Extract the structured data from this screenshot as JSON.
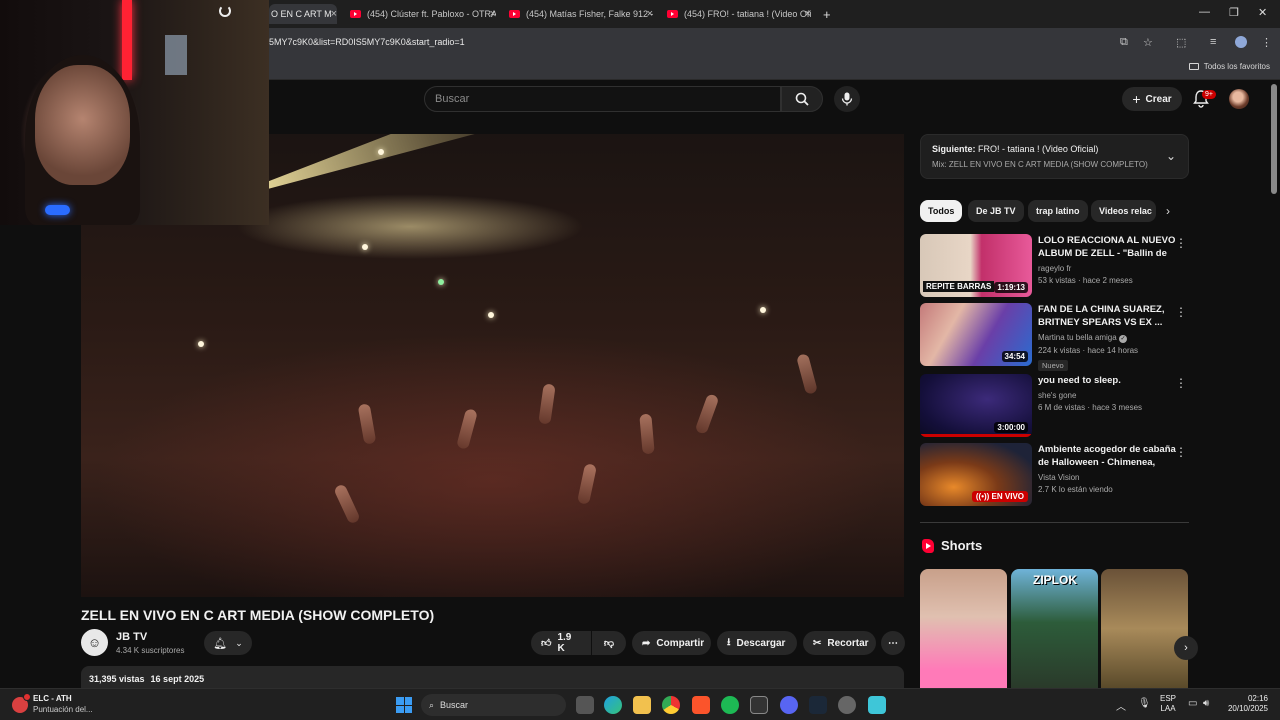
{
  "browser": {
    "tabs": [
      {
        "label": "O EN C ART M"
      },
      {
        "label": "(454) Clúster ft. Pabloxo - OTRA"
      },
      {
        "label": "(454) Matías Fisher, Falke 912 -"
      },
      {
        "label": "(454) FRO! - tatiana ! (Video Ofi"
      }
    ],
    "new_tab": "+",
    "url": "5MY7c9K0&list=RD0IS5MY7c9K0&start_radio=1",
    "bookmarks_all": "Todos los favoritos"
  },
  "header": {
    "search_placeholder": "Buscar",
    "create_label": "Crear",
    "notifications_badge": "9+"
  },
  "video": {
    "title": "ZELL EN VIVO EN C ART MEDIA (SHOW COMPLETO)",
    "channel": "JB TV",
    "subscribers": "4.34 K suscriptores",
    "likes": "1.9 K",
    "share_label": "Compartir",
    "download_label": "Descargar",
    "clip_label": "Recortar",
    "views": "31,395 vistas",
    "date": "16 sept 2025"
  },
  "up_next": {
    "prefix": "Siguiente:",
    "title": "FRO! - tatiana ! (Video Oficial)",
    "mix": "Mix: ZELL EN VIVO EN C ART MEDIA (SHOW COMPLETO)"
  },
  "chips": [
    "Todos",
    "De JB TV",
    "trap latino",
    "Videos relac"
  ],
  "recommendations": [
    {
      "title": "LOLO REACCIONA AL NUEVO ALBUM DE ZELL - \"Ballin de ...",
      "channel": "rageylo fr",
      "meta": "53 k vistas · hace 2 meses",
      "duration": "1:19:13",
      "thumb_text": "REPITE BARRAS"
    },
    {
      "title": "FAN DE LA CHINA SUAREZ, BRITNEY SPEARS VS EX ...",
      "channel": "Martina tu bella amiga",
      "meta": "224 k vistas · hace 14 horas",
      "badge": "Nuevo",
      "duration": "34:54"
    },
    {
      "title": "you need to sleep.",
      "channel": "she's gone",
      "meta": "6 M de vistas · hace 3 meses",
      "duration": "3:00:00"
    },
    {
      "title": "Ambiente acogedor de cabaña de Halloween - Chimenea, lluvi...",
      "channel": "Vista Vision",
      "meta": "2.7 K lo están viendo",
      "live": "EN VIVO"
    }
  ],
  "shorts": {
    "heading": "Shorts",
    "items": [
      {
        "caption": ""
      },
      {
        "caption": "ZIPLOK"
      },
      {
        "caption": ""
      }
    ]
  },
  "taskbar": {
    "weather_title": "ELC - ATH",
    "weather_sub": "Puntuación del...",
    "search_label": "Buscar",
    "lang": "ESP",
    "lang2": "LAA",
    "time": "02:16",
    "date": "20/10/2025"
  }
}
